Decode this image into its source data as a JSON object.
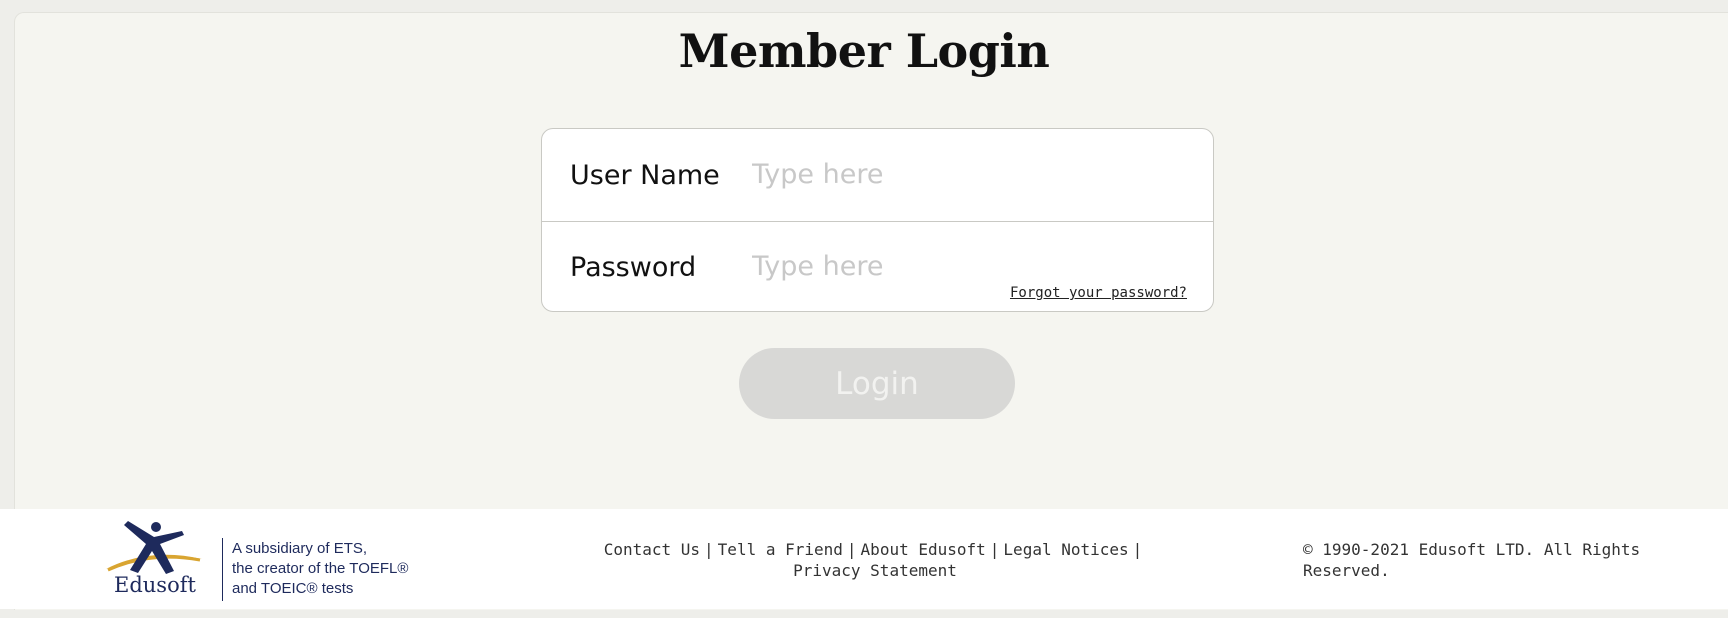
{
  "page": {
    "title": "Member Login"
  },
  "form": {
    "username_label": "User Name",
    "username_placeholder": "Type here",
    "username_value": "",
    "password_label": "Password",
    "password_placeholder": "Type here",
    "password_value": "",
    "forgot_link": "Forgot your password?",
    "login_button": "Login"
  },
  "footer": {
    "logo_text": "Edusoft",
    "logo_icon": "edusoft-figure-icon",
    "tagline_lines": [
      "A subsidiary of ETS,",
      "the creator of the TOEFL®",
      "and TOEIC® tests"
    ],
    "links": {
      "contact": "Contact Us",
      "tell_friend": "Tell a Friend",
      "about": "About Edusoft",
      "legal": "Legal Notices",
      "privacy": "Privacy Statement",
      "separator": "|"
    },
    "copyright": "© 1990-2021 Edusoft LTD. All Rights Reserved."
  },
  "colors": {
    "background": "#f5f5f0",
    "brand_navy": "#1e2a5c",
    "brand_gold": "#d9a531",
    "button_disabled": "#d8d8d6"
  }
}
